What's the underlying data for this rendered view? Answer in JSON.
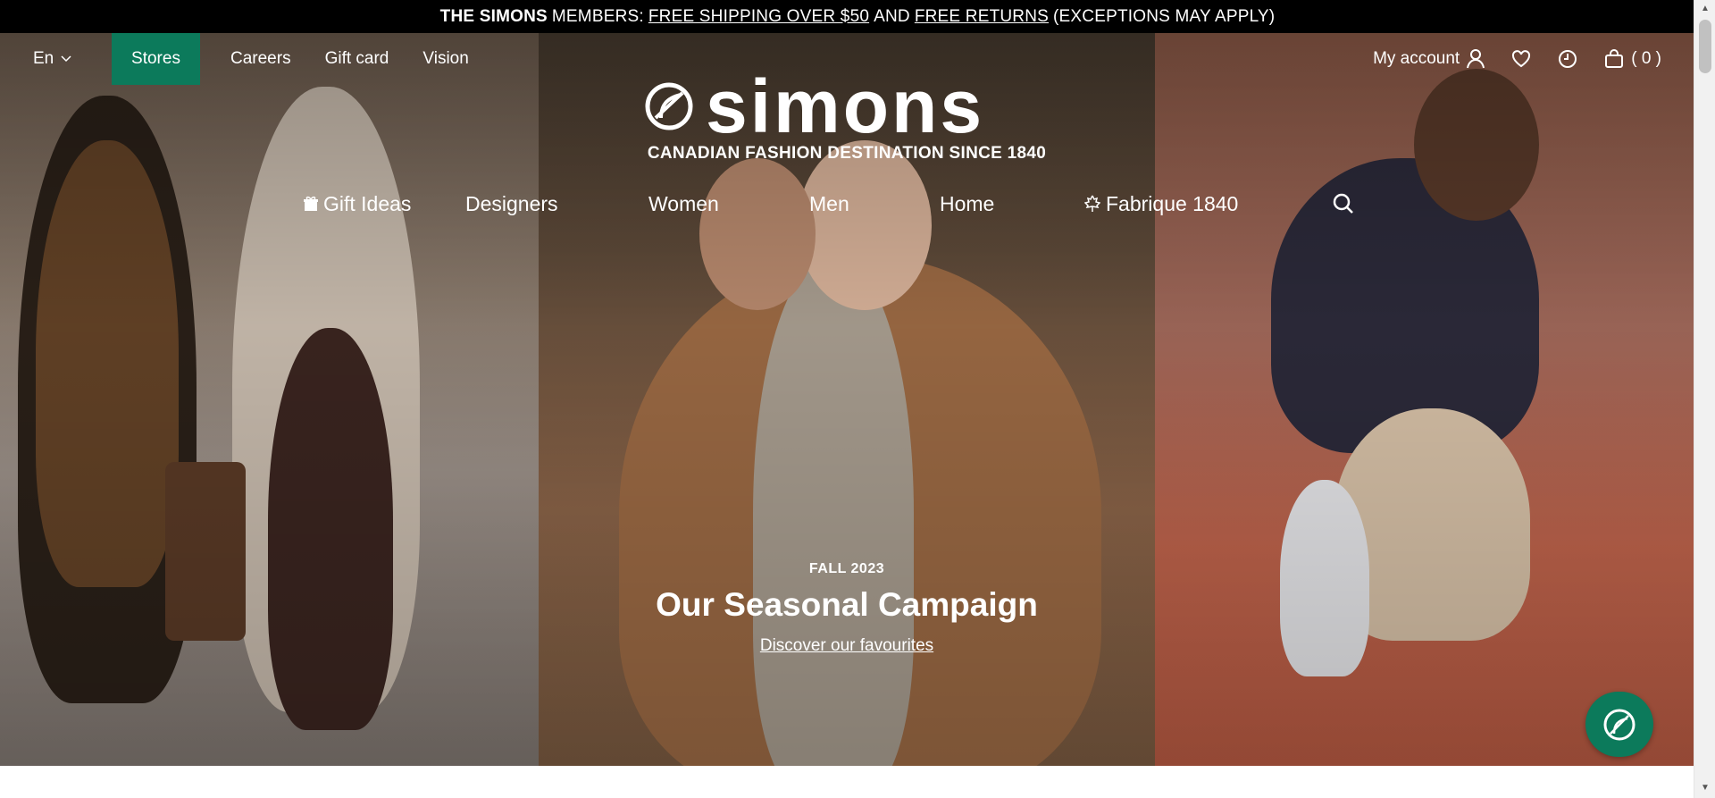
{
  "promo": {
    "brand": "THE SIMONS",
    "members": "MEMBERS:",
    "shipping": "FREE SHIPPING OVER $50",
    "and": "AND",
    "returns": "FREE RETURNS",
    "exceptions": "(EXCEPTIONS MAY APPLY)"
  },
  "utility": {
    "language": "En",
    "stores": "Stores",
    "links": [
      "Careers",
      "Gift card",
      "Vision"
    ]
  },
  "account": {
    "my_account": "My account",
    "cart_count": "( 0 )"
  },
  "brand": {
    "logo": "simons",
    "tagline": "CANADIAN FASHION DESTINATION SINCE 1840"
  },
  "nav": {
    "items": [
      "Gift Ideas",
      "Designers",
      "Women",
      "Men",
      "Home",
      "Fabrique 1840"
    ]
  },
  "campaign": {
    "season": "FALL 2023",
    "headline": "Our Seasonal Campaign",
    "cta": "Discover our favourites"
  },
  "colors": {
    "accent": "#0c7a5b",
    "promo_bg": "#000000"
  },
  "icons": [
    "chevron-down-icon",
    "user-icon",
    "heart-icon",
    "clock-icon",
    "bag-icon",
    "gift-icon",
    "maple-leaf-icon",
    "search-icon",
    "chat-icon"
  ]
}
